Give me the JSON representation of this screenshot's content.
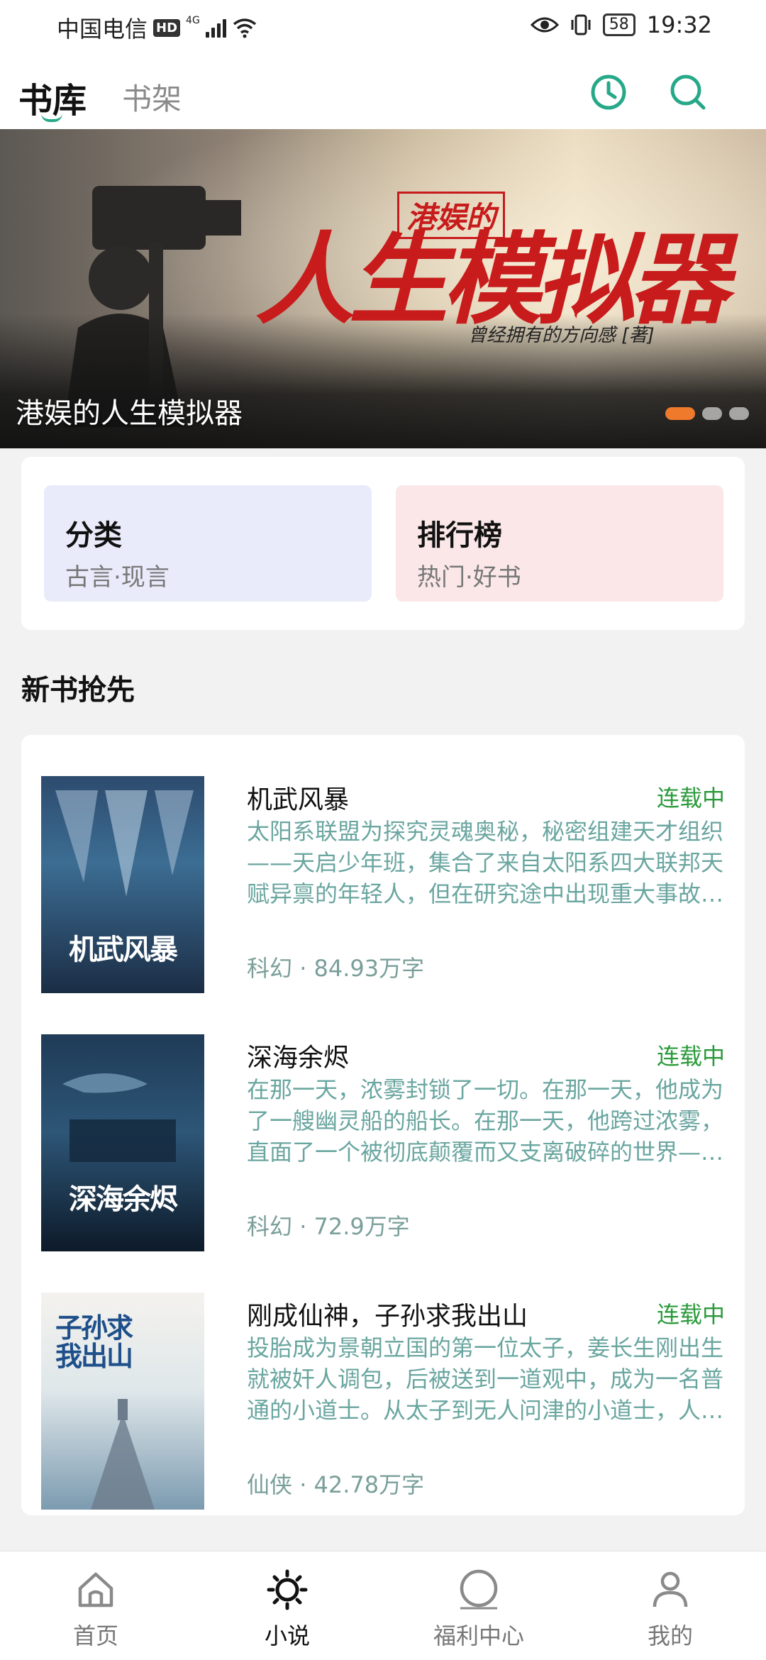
{
  "status_bar": {
    "carrier": "中国电信",
    "hd": "HD",
    "network": "4G",
    "battery": "58",
    "time": "19:32"
  },
  "header": {
    "tabs": [
      {
        "label": "书库",
        "active": true
      },
      {
        "label": "书架",
        "active": false
      }
    ],
    "icons": [
      "history-clock-icon",
      "search-icon"
    ],
    "accent_color": "#27a889"
  },
  "banner": {
    "title": "港娱的人生模拟器",
    "art_series": "港娱的",
    "art_headline": "人生模拟器",
    "art_author": "曾经拥有的方向感",
    "art_author_suffix": "著",
    "dots": 3,
    "active_dot": 0
  },
  "quick_links": [
    {
      "title": "分类",
      "subtitle": "古言·现言"
    },
    {
      "title": "排行榜",
      "subtitle": "热门·好书"
    }
  ],
  "section": {
    "title": "新书抢先"
  },
  "books": [
    {
      "name": "机武风暴",
      "status": "连载中",
      "description": "太阳系联盟为探究灵魂奥秘，秘密组建天才组织——天启少年班，集合了来自太阳系四大联邦天赋异禀的年轻人，但在研究途中出现重大事故…",
      "genre": "科幻",
      "words": "84.93万字",
      "cover_text": "机武风暴"
    },
    {
      "name": "深海余烬",
      "status": "连载中",
      "description": "在那一天，浓雾封锁了一切。在那一天，他成为了一艘幽灵船的船长。在那一天，他跨过浓雾，直面了一个被彻底颠覆而又支离破碎的世界—…",
      "genre": "科幻",
      "words": "72.9万字",
      "cover_text": "深海余烬"
    },
    {
      "name": "刚成仙神，子孙求我出山",
      "status": "连载中",
      "description": "投胎成为景朝立国的第一位太子，姜长生刚出生就被奸人调包，后被送到一道观中，成为一名普通的小道士。从太子到无人问津的小道士，人…",
      "genre": "仙侠",
      "words": "42.78万字",
      "cover_text": "子孙求我出山"
    }
  ],
  "meta_separator": " · ",
  "bottom_nav": [
    {
      "label": "首页",
      "icon": "home-icon",
      "active": false
    },
    {
      "label": "小说",
      "icon": "sun-icon",
      "active": true
    },
    {
      "label": "福利中心",
      "icon": "circle-icon",
      "active": false
    },
    {
      "label": "我的",
      "icon": "person-icon",
      "active": false
    }
  ]
}
